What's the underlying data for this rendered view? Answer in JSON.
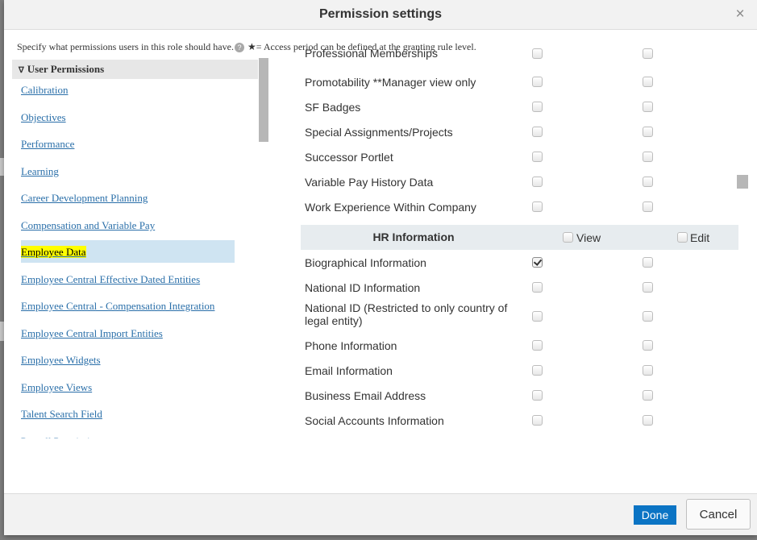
{
  "dialog": {
    "title": "Permission settings",
    "close_glyph": "×",
    "close_icon": "close-icon"
  },
  "instructions": {
    "text": "Specify what permissions users in this role should have.",
    "help_icon": "help-icon",
    "help_glyph": "?",
    "star_note": "★= Access period can be defined at the granting rule level."
  },
  "sidebar": {
    "section_label": "User Permissions",
    "section_chevron": "∇",
    "items": [
      {
        "label": "Calibration"
      },
      {
        "label": "Objectives"
      },
      {
        "label": "Performance"
      },
      {
        "label": "Learning"
      },
      {
        "label": "Career Development Planning"
      },
      {
        "label": "Compensation and Variable Pay"
      },
      {
        "label": "Employee Data",
        "selected": true
      },
      {
        "label": "Employee Central Effective Dated Entities"
      },
      {
        "label": "Employee Central - Compensation Integration"
      },
      {
        "label": "Employee Central Import Entities"
      },
      {
        "label": "Employee Widgets"
      },
      {
        "label": "Employee Views"
      },
      {
        "label": "Talent Search Field"
      },
      {
        "label": "Payroll Permissions"
      }
    ]
  },
  "permissions": {
    "rows_top": [
      {
        "label": "Professional Memberships",
        "view": false,
        "edit": false
      },
      {
        "label": "Promotability **Manager view only",
        "view": false,
        "edit": false
      },
      {
        "label": "SF Badges",
        "view": false,
        "edit": false
      },
      {
        "label": "Special Assignments/Projects",
        "view": false,
        "edit": false
      },
      {
        "label": "Successor Portlet",
        "view": false,
        "edit": false
      },
      {
        "label": "Variable Pay History Data",
        "view": false,
        "edit": false
      },
      {
        "label": "Work Experience Within Company",
        "view": false,
        "edit": false
      }
    ],
    "hr_section": {
      "title": "HR Information",
      "view_label": "View",
      "edit_label": "Edit",
      "view_all": false,
      "edit_all": false
    },
    "rows_hr": [
      {
        "label": "Biographical Information",
        "view": true,
        "edit": false
      },
      {
        "label": "National ID Information",
        "view": false,
        "edit": false
      },
      {
        "label": "National ID (Restricted to only country of legal entity)",
        "view": false,
        "edit": false
      },
      {
        "label": "Phone Information",
        "view": false,
        "edit": false
      },
      {
        "label": "Email Information",
        "view": false,
        "edit": false
      },
      {
        "label": "Business Email Address",
        "view": false,
        "edit": false
      },
      {
        "label": "Social Accounts Information",
        "view": false,
        "edit": false
      }
    ]
  },
  "footer": {
    "done_label": "Done",
    "cancel_label": "Cancel"
  },
  "colors": {
    "accent": "#0b74c4",
    "link": "#2a6fa9",
    "highlight": "#ffff00",
    "selected_row": "#cfe4f2"
  }
}
